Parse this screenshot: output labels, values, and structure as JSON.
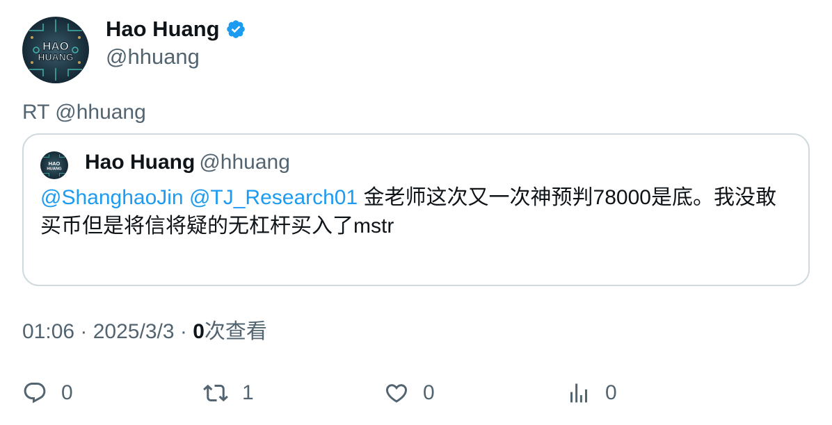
{
  "author": {
    "name": "Hao Huang",
    "handle": "@hhuang",
    "avatar_text_line1": "HAO",
    "avatar_text_line2": "HUANG"
  },
  "retweet_label": "RT @hhuang",
  "quoted": {
    "name": "Hao Huang",
    "handle": "@hhuang",
    "mention1": "@ShanghaoJin",
    "mention2": "@TJ_Research01",
    "text": " 金老师这次又一次神预判78000是底。我没敢买币但是将信将疑的无杠杆买入了mstr"
  },
  "meta": {
    "time": "01:06",
    "sep": " · ",
    "date": "2025/3/3",
    "views_count": "0",
    "views_label": "次查看"
  },
  "actions": {
    "reply_count": "0",
    "retweet_count": "1",
    "like_count": "0",
    "views_count": "0"
  },
  "colors": {
    "accent": "#1d9bf0",
    "secondary_text": "#536471",
    "border": "#cfd9de"
  }
}
